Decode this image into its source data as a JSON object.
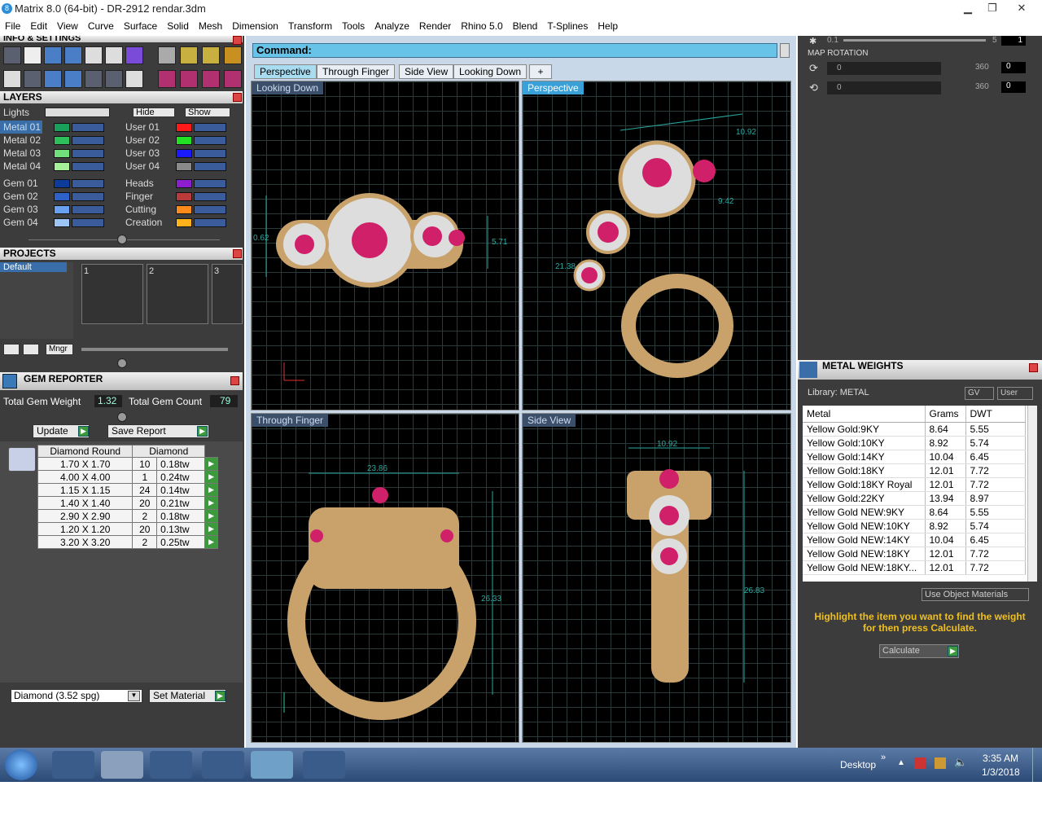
{
  "window": {
    "title": "Matrix 8.0 (64-bit) - DR-2912 rendar.3dm",
    "logo": "8"
  },
  "menu": [
    "File",
    "Edit",
    "View",
    "Curve",
    "Surface",
    "Solid",
    "Mesh",
    "Dimension",
    "Transform",
    "Tools",
    "Analyze",
    "Render",
    "Rhino 5.0",
    "Blend",
    "T-Splines",
    "Help"
  ],
  "info_settings": {
    "title": "INFO & SETTINGS"
  },
  "layers": {
    "title": "LAYERS",
    "lights": "Lights",
    "hide": "Hide",
    "show": "Show",
    "left": [
      {
        "name": "Metal 01",
        "color": "#19a05a"
      },
      {
        "name": "Metal 02",
        "color": "#2fbf5a"
      },
      {
        "name": "Metal 03",
        "color": "#6fe07a"
      },
      {
        "name": "Metal 04",
        "color": "#a6f09a"
      },
      {
        "name": "Gem 01",
        "color": "#0d3b9a"
      },
      {
        "name": "Gem 02",
        "color": "#2e62c8"
      },
      {
        "name": "Gem 03",
        "color": "#6aa0f0"
      },
      {
        "name": "Gem 04",
        "color": "#9cc4f4"
      }
    ],
    "right": [
      {
        "name": "User 01",
        "color": "#ff1a1a"
      },
      {
        "name": "User 02",
        "color": "#22e022"
      },
      {
        "name": "User 03",
        "color": "#1a1aff"
      },
      {
        "name": "User 04",
        "color": "#8a8a8a"
      },
      {
        "name": "Heads",
        "color": "#8c1ed0"
      },
      {
        "name": "Finger",
        "color": "#b83a3a"
      },
      {
        "name": "Cutting",
        "color": "#ff8c1a"
      },
      {
        "name": "Creation",
        "color": "#ffb21a"
      }
    ]
  },
  "projects": {
    "title": "PROJECTS",
    "default": "Default",
    "slots": [
      "1",
      "2",
      "3"
    ],
    "mngr": "Mngr"
  },
  "gem_reporter": {
    "title": "GEM REPORTER",
    "total_weight_label": "Total Gem Weight",
    "total_weight": "1.32",
    "total_count_label": "Total Gem Count",
    "total_count": "79",
    "update": "Update",
    "save_report": "Save Report",
    "col1": "Diamond Round",
    "col2": "Diamond",
    "rows": [
      [
        "1.70 X 1.70",
        "10",
        "0.18tw"
      ],
      [
        "4.00 X 4.00",
        "1",
        "0.24tw"
      ],
      [
        "1.15 X 1.15",
        "24",
        "0.14tw"
      ],
      [
        "1.40 X 1.40",
        "20",
        "0.21tw"
      ],
      [
        "2.90 X 2.90",
        "2",
        "0.18tw"
      ],
      [
        "1.20 X 1.20",
        "20",
        "0.13tw"
      ],
      [
        "3.20 X 3.20",
        "2",
        "0.25tw"
      ]
    ],
    "material": "Diamond    (3.52 spg)",
    "set_material": "Set Material"
  },
  "command": {
    "label": "Command:"
  },
  "tabs": [
    "Perspective",
    "Through Finger",
    "Side View",
    "Looking Down"
  ],
  "viewports": {
    "tl": "Looking Down",
    "tr": "Perspective",
    "bl": "Through Finger",
    "br": "Side View"
  },
  "dims": {
    "tl_a": "0.62",
    "tl_b": "5.71",
    "tr_a": "10.92",
    "tr_b": "21.38",
    "tr_c": "9.42",
    "bl_a": "23.86",
    "bl_b": "26.33",
    "br_a": "10.92",
    "br_b": "26.83"
  },
  "right_top": {
    "slider1_min": "0.1",
    "slider1_max": "5",
    "slider1_val": "1",
    "map_rotation": "MAP ROTATION",
    "rot1_min": "0",
    "rot1_max": "360",
    "rot1_val": "0",
    "rot2_min": "0",
    "rot2_max": "360",
    "rot2_val": "0"
  },
  "metal_weights": {
    "title": "METAL WEIGHTS",
    "library": "Library: METAL",
    "gv": "GV",
    "user": "User",
    "col_metal": "Metal",
    "col_grams": "Grams",
    "col_dwt": "DWT",
    "rows": [
      [
        "Yellow Gold:9KY",
        "8.64",
        "5.55"
      ],
      [
        "Yellow Gold:10KY",
        "8.92",
        "5.74"
      ],
      [
        "Yellow Gold:14KY",
        "10.04",
        "6.45"
      ],
      [
        "Yellow Gold:18KY",
        "12.01",
        "7.72"
      ],
      [
        "Yellow Gold:18KY Royal",
        "12.01",
        "7.72"
      ],
      [
        "Yellow Gold:22KY",
        "13.94",
        "8.97"
      ],
      [
        "Yellow Gold NEW:9KY",
        "8.64",
        "5.55"
      ],
      [
        "Yellow Gold NEW:10KY",
        "8.92",
        "5.74"
      ],
      [
        "Yellow Gold NEW:14KY",
        "10.04",
        "6.45"
      ],
      [
        "Yellow Gold NEW:18KY",
        "12.01",
        "7.72"
      ],
      [
        "Yellow Gold NEW:18KY...",
        "12.01",
        "7.72"
      ]
    ],
    "use_object_materials": "Use Object Materials",
    "hint": "Highlight the item you want to find the weight for then press Calculate.",
    "calculate": "Calculate"
  },
  "taskbar": {
    "desktop": "Desktop",
    "time": "3:35 AM",
    "date": "1/3/2018"
  },
  "colors": {
    "accent": "#67c4e8",
    "panel": "#3c3c3c",
    "gold": "#c8a26a",
    "ruby": "#d0206a"
  }
}
